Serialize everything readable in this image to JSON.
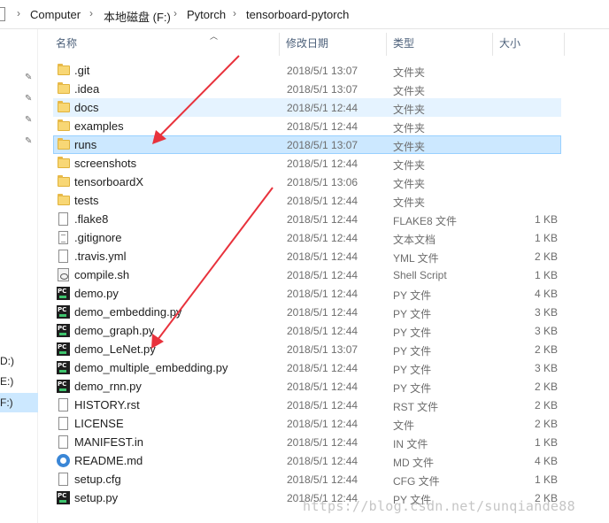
{
  "breadcrumb": [
    "Computer",
    "本地磁盘 (F:)",
    "Pytorch",
    "tensorboard-pytorch"
  ],
  "nav": {
    "drives": [
      "D:)",
      "E:)",
      "F:)"
    ]
  },
  "columns": {
    "name": "名称",
    "date": "修改日期",
    "type": "类型",
    "size": "大小"
  },
  "files": [
    {
      "name": ".git",
      "date": "2018/5/1 13:07",
      "type": "文件夹",
      "size": "",
      "icon": "folder-icon"
    },
    {
      "name": ".idea",
      "date": "2018/5/1 13:07",
      "type": "文件夹",
      "size": "",
      "icon": "folder-icon"
    },
    {
      "name": "docs",
      "date": "2018/5/1 12:44",
      "type": "文件夹",
      "size": "",
      "icon": "folder-icon"
    },
    {
      "name": "examples",
      "date": "2018/5/1 12:44",
      "type": "文件夹",
      "size": "",
      "icon": "folder-icon"
    },
    {
      "name": "runs",
      "date": "2018/5/1 13:07",
      "type": "文件夹",
      "size": "",
      "icon": "folder-icon"
    },
    {
      "name": "screenshots",
      "date": "2018/5/1 12:44",
      "type": "文件夹",
      "size": "",
      "icon": "folder-icon"
    },
    {
      "name": "tensorboardX",
      "date": "2018/5/1 13:06",
      "type": "文件夹",
      "size": "",
      "icon": "folder-icon"
    },
    {
      "name": "tests",
      "date": "2018/5/1 12:44",
      "type": "文件夹",
      "size": "",
      "icon": "folder-icon"
    },
    {
      "name": ".flake8",
      "date": "2018/5/1 12:44",
      "type": "FLAKE8 文件",
      "size": "1 KB",
      "icon": "file-icon"
    },
    {
      "name": ".gitignore",
      "date": "2018/5/1 12:44",
      "type": "文本文档",
      "size": "1 KB",
      "icon": "text-file-icon"
    },
    {
      "name": ".travis.yml",
      "date": "2018/5/1 12:44",
      "type": "YML 文件",
      "size": "2 KB",
      "icon": "file-icon"
    },
    {
      "name": "compile.sh",
      "date": "2018/5/1 12:44",
      "type": "Shell Script",
      "size": "1 KB",
      "icon": "shell-script-icon"
    },
    {
      "name": "demo.py",
      "date": "2018/5/1 12:44",
      "type": "PY 文件",
      "size": "4 KB",
      "icon": "pycharm-icon"
    },
    {
      "name": "demo_embedding.py",
      "date": "2018/5/1 12:44",
      "type": "PY 文件",
      "size": "3 KB",
      "icon": "pycharm-icon"
    },
    {
      "name": "demo_graph.py",
      "date": "2018/5/1 12:44",
      "type": "PY 文件",
      "size": "3 KB",
      "icon": "pycharm-icon"
    },
    {
      "name": "demo_LeNet.py",
      "date": "2018/5/1 13:07",
      "type": "PY 文件",
      "size": "2 KB",
      "icon": "pycharm-icon"
    },
    {
      "name": "demo_multiple_embedding.py",
      "date": "2018/5/1 12:44",
      "type": "PY 文件",
      "size": "3 KB",
      "icon": "pycharm-icon"
    },
    {
      "name": "demo_rnn.py",
      "date": "2018/5/1 12:44",
      "type": "PY 文件",
      "size": "2 KB",
      "icon": "pycharm-icon"
    },
    {
      "name": "HISTORY.rst",
      "date": "2018/5/1 12:44",
      "type": "RST 文件",
      "size": "2 KB",
      "icon": "file-icon"
    },
    {
      "name": "LICENSE",
      "date": "2018/5/1 12:44",
      "type": "文件",
      "size": "2 KB",
      "icon": "file-icon"
    },
    {
      "name": "MANIFEST.in",
      "date": "2018/5/1 12:44",
      "type": "IN 文件",
      "size": "1 KB",
      "icon": "file-icon"
    },
    {
      "name": "README.md",
      "date": "2018/5/1 12:44",
      "type": "MD 文件",
      "size": "4 KB",
      "icon": "markdown-app-icon"
    },
    {
      "name": "setup.cfg",
      "date": "2018/5/1 12:44",
      "type": "CFG 文件",
      "size": "1 KB",
      "icon": "file-icon"
    },
    {
      "name": "setup.py",
      "date": "2018/5/1 12:44",
      "type": "PY 文件",
      "size": "2 KB",
      "icon": "pycharm-icon"
    }
  ],
  "highlight": {
    "hover_row": "docs",
    "selected_row": "runs"
  },
  "annotation_color": "#e8323c",
  "watermark": "https://blog.csdn.net/sunqiande88"
}
